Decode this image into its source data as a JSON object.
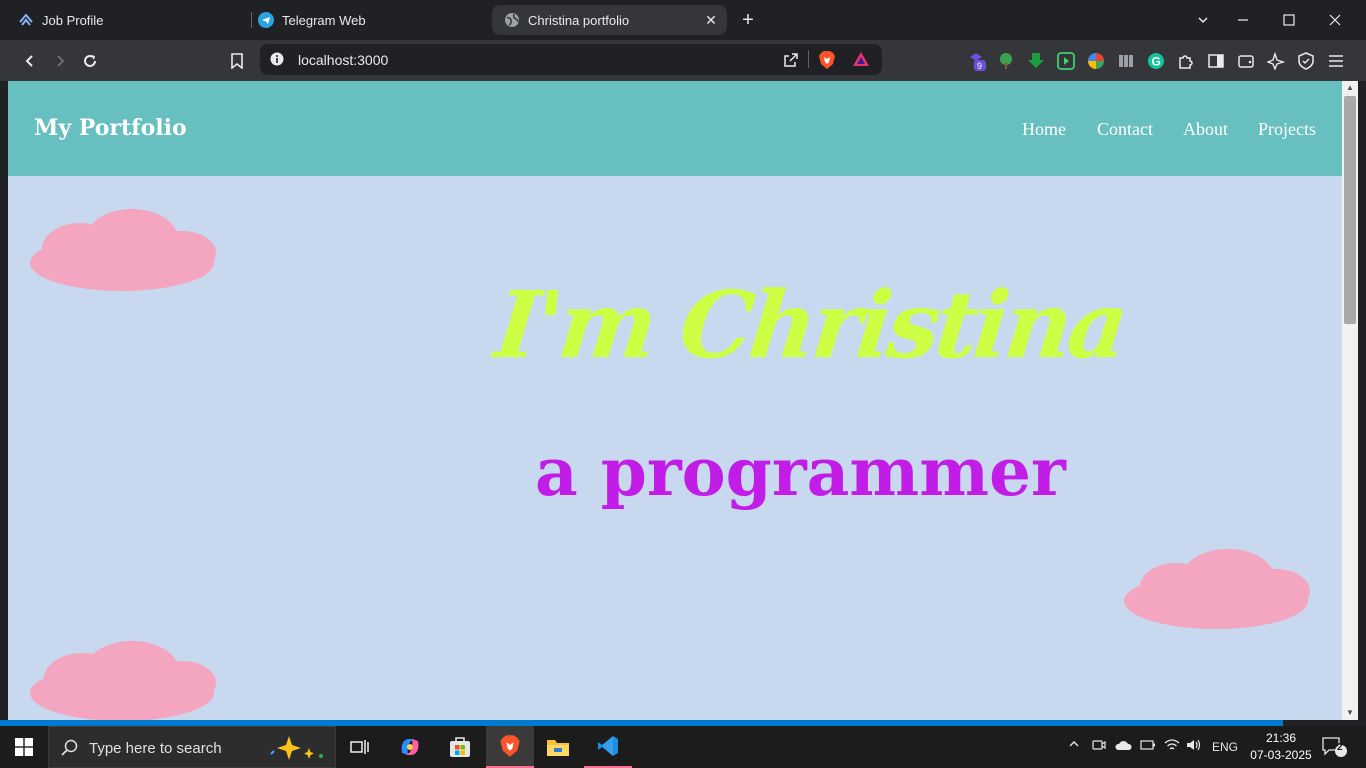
{
  "browser": {
    "tabs": [
      {
        "title": "Job Profile",
        "icon": "job-profile-icon"
      },
      {
        "title": "Telegram Web",
        "icon": "telegram-icon"
      },
      {
        "title": "Christina portfolio",
        "icon": "globe-icon",
        "active": true
      }
    ],
    "url": "localhost:3000"
  },
  "page": {
    "brand": "My Portfolio",
    "nav": [
      "Home",
      "Contact",
      "About",
      "Projects"
    ],
    "hero_name": "I'm Christina",
    "hero_role": "a programmer",
    "colors": {
      "navbar": "#67bfbf",
      "background": "#c8d8ee",
      "name": "#cfff45",
      "role": "#c21de6",
      "cloud": "#f4a6c0"
    }
  },
  "taskbar": {
    "search_placeholder": "Type here to search",
    "language": "ENG",
    "time": "21:36",
    "date": "07-03-2025",
    "notification_count": "2"
  }
}
